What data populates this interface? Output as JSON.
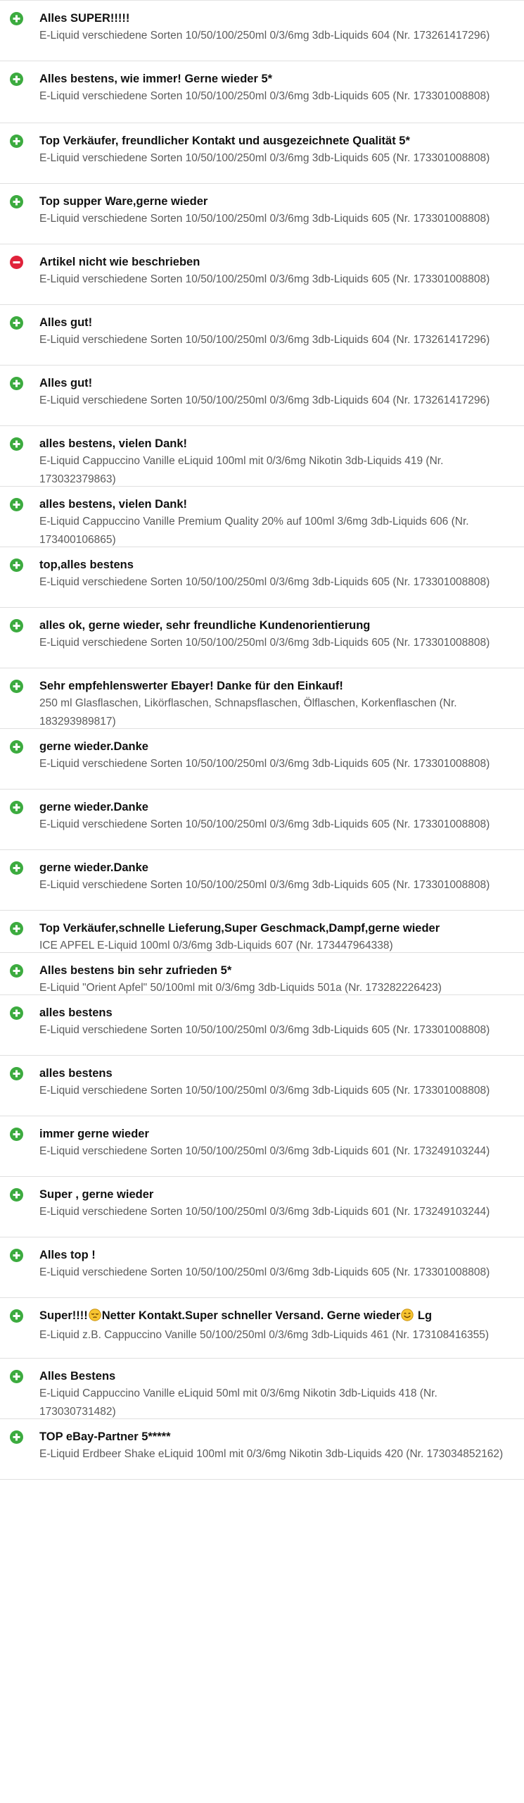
{
  "colors": {
    "positive": "#3cab3f",
    "negative": "#e0223a"
  },
  "feedback": [
    {
      "type": "positive",
      "comment": "Alles SUPER!!!!!",
      "item": "E-Liquid verschiedene Sorten 10/50/100/250ml 0/3/6mg 3db-Liquids 604 (Nr. 173261417296)"
    },
    {
      "type": "positive",
      "comment": "Alles bestens, wie immer! Gerne wieder 5*",
      "item": "E-Liquid verschiedene Sorten 10/50/100/250ml 0/3/6mg 3db-Liquids 605 (Nr. 173301008808)"
    },
    {
      "type": "positive",
      "comment": "Top Verkäufer, freundlicher Kontakt und ausgezeichnete Qualität 5*",
      "item": "E-Liquid verschiedene Sorten 10/50/100/250ml 0/3/6mg 3db-Liquids 605 (Nr. 173301008808)"
    },
    {
      "type": "positive",
      "comment": "Top supper Ware,gerne wieder",
      "item": "E-Liquid verschiedene Sorten 10/50/100/250ml 0/3/6mg 3db-Liquids 605 (Nr. 173301008808)"
    },
    {
      "type": "negative",
      "comment": "Artikel nicht wie beschrieben",
      "item": "E-Liquid verschiedene Sorten 10/50/100/250ml 0/3/6mg 3db-Liquids 605 (Nr. 173301008808)"
    },
    {
      "type": "positive",
      "comment": "Alles gut!",
      "item": "E-Liquid verschiedene Sorten 10/50/100/250ml 0/3/6mg 3db-Liquids 604 (Nr. 173261417296)"
    },
    {
      "type": "positive",
      "comment": "Alles gut!",
      "item": "E-Liquid verschiedene Sorten 10/50/100/250ml 0/3/6mg 3db-Liquids 604 (Nr. 173261417296)"
    },
    {
      "type": "positive",
      "comment": "alles bestens, vielen Dank!",
      "item": "E-Liquid Cappuccino Vanille eLiquid 100ml mit 0/3/6mg Nikotin 3db-Liquids 419 (Nr. 173032379863)"
    },
    {
      "type": "positive",
      "comment": "alles bestens, vielen Dank!",
      "item": "E-Liquid Cappuccino Vanille Premium Quality 20% auf 100ml 3/6mg 3db-Liquids 606 (Nr. 173400106865)"
    },
    {
      "type": "positive",
      "comment": "top,alles bestens",
      "item": "E-Liquid verschiedene Sorten 10/50/100/250ml 0/3/6mg 3db-Liquids 605 (Nr. 173301008808)"
    },
    {
      "type": "positive",
      "comment": "alles ok, gerne wieder, sehr freundliche Kundenorientierung",
      "item": "E-Liquid verschiedene Sorten 10/50/100/250ml 0/3/6mg 3db-Liquids 605 (Nr. 173301008808)"
    },
    {
      "type": "positive",
      "comment": "Sehr empfehlenswerter Ebayer! Danke für den Einkauf!",
      "item": "250 ml Glasflaschen, Likörflaschen, Schnapsflaschen, Ölflaschen, Korkenflaschen (Nr. 183293989817)"
    },
    {
      "type": "positive",
      "comment": "gerne wieder.Danke",
      "item": "E-Liquid verschiedene Sorten 10/50/100/250ml 0/3/6mg 3db-Liquids 605 (Nr. 173301008808)"
    },
    {
      "type": "positive",
      "comment": "gerne wieder.Danke",
      "item": "E-Liquid verschiedene Sorten 10/50/100/250ml 0/3/6mg 3db-Liquids 605 (Nr. 173301008808)"
    },
    {
      "type": "positive",
      "comment": "gerne wieder.Danke",
      "item": "E-Liquid verschiedene Sorten 10/50/100/250ml 0/3/6mg 3db-Liquids 605 (Nr. 173301008808)"
    },
    {
      "type": "positive",
      "comment": "Top Verkäufer,schnelle Lieferung,Super Geschmack,Dampf,gerne wieder",
      "item": "ICE APFEL E-Liquid 100ml 0/3/6mg 3db-Liquids 607 (Nr. 173447964338)"
    },
    {
      "type": "positive",
      "comment": "Alles bestens bin sehr zufrieden 5*",
      "item": "E-Liquid \"Orient Apfel\" 50/100ml mit 0/3/6mg 3db-Liquids 501a (Nr. 173282226423)"
    },
    {
      "type": "positive",
      "comment": "alles bestens",
      "item": "E-Liquid verschiedene Sorten 10/50/100/250ml 0/3/6mg 3db-Liquids 605 (Nr. 173301008808)"
    },
    {
      "type": "positive",
      "comment": "alles bestens",
      "item": "E-Liquid verschiedene Sorten 10/50/100/250ml 0/3/6mg 3db-Liquids 605 (Nr. 173301008808)"
    },
    {
      "type": "positive",
      "comment": "immer gerne wieder",
      "item": "E-Liquid verschiedene Sorten 10/50/100/250ml 0/3/6mg 3db-Liquids 601 (Nr. 173249103244)"
    },
    {
      "type": "positive",
      "comment": "Super , gerne wieder",
      "item": "E-Liquid verschiedene Sorten 10/50/100/250ml 0/3/6mg 3db-Liquids 601 (Nr. 173249103244)"
    },
    {
      "type": "positive",
      "comment": "Alles top !",
      "item": "E-Liquid verschiedene Sorten 10/50/100/250ml 0/3/6mg 3db-Liquids 605 (Nr. 173301008808)"
    },
    {
      "type": "positive",
      "comment_parts": [
        {
          "text": "Super!!!!"
        },
        {
          "emoji": "sleepy-face-emoji"
        },
        {
          "text": "Netter Kontakt.Super schneller Versand. Gerne wieder"
        },
        {
          "emoji": "smiling-face-emoji"
        },
        {
          "text": " Lg"
        }
      ],
      "item": "E-Liquid z.B. Cappuccino Vanille 50/100/250ml 0/3/6mg 3db-Liquids 461 (Nr. 173108416355)"
    },
    {
      "type": "positive",
      "comment": "Alles Bestens",
      "item": "E-Liquid Cappuccino Vanille eLiquid 50ml mit 0/3/6mg Nikotin 3db-Liquids 418 (Nr. 173030731482)"
    },
    {
      "type": "positive",
      "comment": "TOP eBay-Partner 5*****",
      "item": "E-Liquid Erdbeer Shake eLiquid 100ml mit 0/3/6mg Nikotin 3db-Liquids 420 (Nr. 173034852162)"
    }
  ]
}
